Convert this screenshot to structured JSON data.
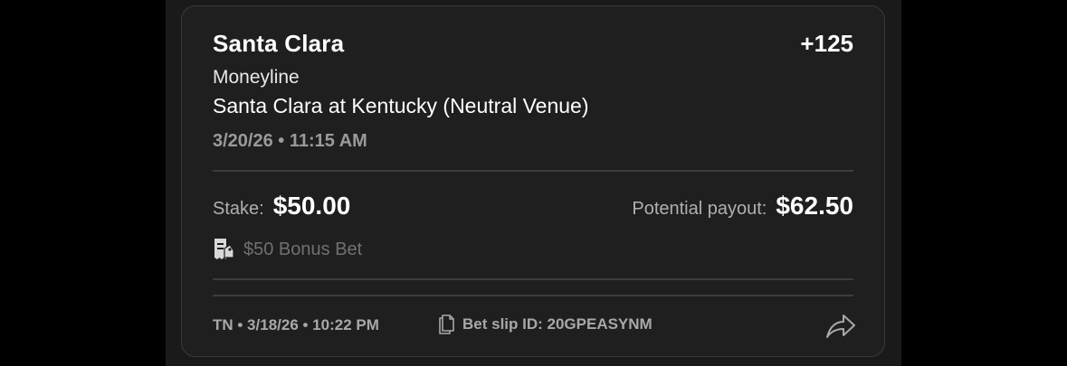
{
  "bet": {
    "selection": "Santa Clara",
    "odds": "+125",
    "market": "Moneyline",
    "event": "Santa Clara at Kentucky (Neutral Venue)",
    "event_time": "3/20/26 • 11:15 AM",
    "stake_label": "Stake:",
    "stake_value": "$50.00",
    "payout_label": "Potential payout:",
    "payout_value": "$62.50",
    "bonus_text": "$50 Bonus Bet",
    "bonus_icon": "bonus-bet-receipt-icon"
  },
  "footer": {
    "placed_meta": "TN • 3/18/26 • 10:22 PM",
    "slip_id": "Bet slip ID: 20GPEASYNM",
    "slip_icon": "document-icon",
    "share_icon": "share-arrow-icon"
  },
  "colors": {
    "background": "#000000",
    "panel": "#1a1a1a",
    "card": "#1f1f1f",
    "card_border": "#3a3a3a",
    "text_primary": "#ffffff",
    "text_secondary": "#9a9a9a",
    "text_muted": "#707070"
  }
}
